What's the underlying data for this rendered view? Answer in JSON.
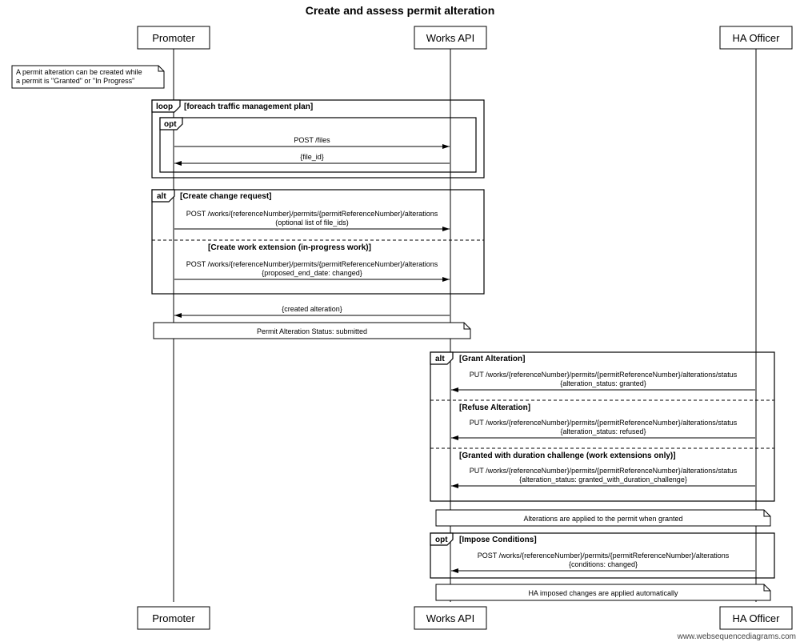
{
  "title": "Create and assess permit alteration",
  "actors": {
    "promoter": "Promoter",
    "worksApi": "Works API",
    "haOfficer": "HA Officer"
  },
  "noteTop": {
    "line1": "A permit alteration can be created while",
    "line2": "a permit is \"Granted\" or \"In Progress\""
  },
  "frames": {
    "loop": {
      "tag": "loop",
      "guard": "[foreach traffic management plan]"
    },
    "opt1": {
      "tag": "opt"
    },
    "alt1": {
      "tag": "alt",
      "guard1": "[Create change request]",
      "guard2": "[Create work extension (in-progress work)]"
    },
    "alt2": {
      "tag": "alt",
      "guard1": "[Grant Alteration]",
      "guard2": "[Refuse Alteration]",
      "guard3": "[Granted with duration challenge (work extensions only)]"
    },
    "opt2": {
      "tag": "opt",
      "guard": "[Impose Conditions]"
    }
  },
  "messages": {
    "postFiles": "POST /files",
    "fileId": "{file_id}",
    "postAlterations1a": "POST /works/{referenceNumber}/permits/{permitReferenceNumber}/alterations",
    "postAlterations1b": "(optional list of file_ids)",
    "postAlterations2a": "POST /works/{referenceNumber}/permits/{permitReferenceNumber}/alterations",
    "postAlterations2b": "{proposed_end_date: changed}",
    "createdAlteration": "{created alteration}",
    "noteSubmitted": "Permit Alteration Status: submitted",
    "putStatus1a": "PUT /works/{referenceNumber}/permits/{permitReferenceNumber}/alterations/status",
    "putStatus1b": "{alteration_status: granted}",
    "putStatus2a": "PUT /works/{referenceNumber}/permits/{permitReferenceNumber}/alterations/status",
    "putStatus2b": "{alteration_status: refused}",
    "putStatus3a": "PUT /works/{referenceNumber}/permits/{permitReferenceNumber}/alterations/status",
    "putStatus3b": "{alteration_status: granted_with_duration_challenge}",
    "noteApplied": "Alterations are applied to the permit when granted",
    "postAlterations3a": "POST /works/{referenceNumber}/permits/{permitReferenceNumber}/alterations",
    "postAlterations3b": "{conditions: changed}",
    "noteHaApplied": "HA imposed changes are applied automatically"
  },
  "footer": "www.websequencediagrams.com"
}
